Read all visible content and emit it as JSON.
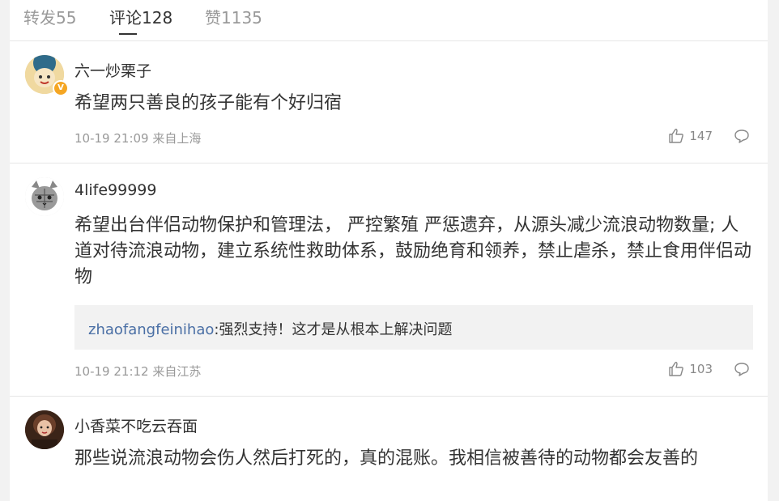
{
  "tabs": [
    {
      "label": "转发55"
    },
    {
      "label": "评论128"
    },
    {
      "label": "赞1135"
    }
  ],
  "comments": [
    {
      "username": "六一炒栗子",
      "text": "希望两只善良的孩子能有个好归宿",
      "time": "10-19 21:09",
      "location": "来自上海",
      "likes": "147",
      "verified": true
    },
    {
      "username": "4life99999",
      "text": "希望出台伴侣动物保护和管理法， 严控繁殖 严惩遗弃，从源头减少流浪动物数量; 人道对待流浪动物，建立系统性救助体系，鼓励绝育和领养，禁止虐杀，禁止食用伴侣动物",
      "reply": {
        "user": "zhaofangfeinihao",
        "text": ":强烈支持！这才是从根本上解决问题"
      },
      "time": "10-19 21:12",
      "location": "来自江苏",
      "likes": "103"
    },
    {
      "username": "小香菜不吃云吞面",
      "text": "那些说流浪动物会伤人然后打死的，真的混账。我相信被善待的动物都会友善的"
    }
  ],
  "colors": {
    "link": "#4a6fa5",
    "badge": "#f5a623",
    "meta": "#999999"
  },
  "icons": [
    "thumbs-up-icon",
    "comment-bubble-icon",
    "verified-badge-icon"
  ]
}
